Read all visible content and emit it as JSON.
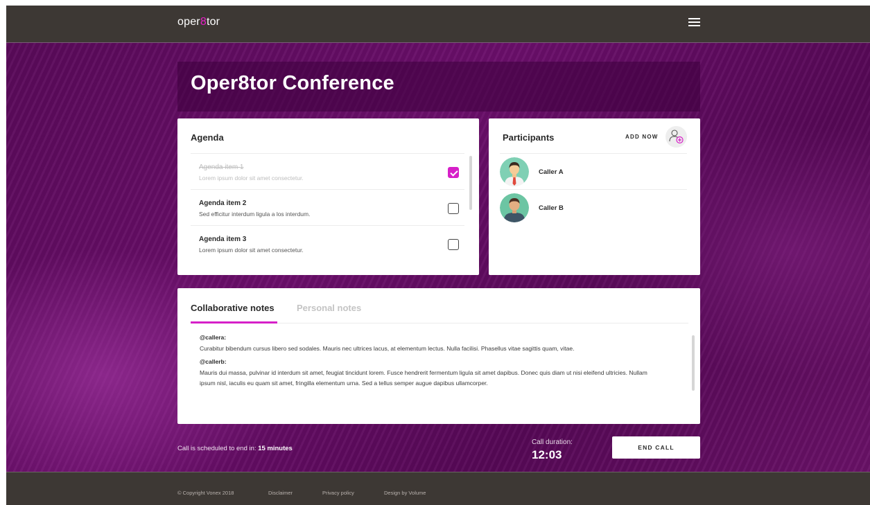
{
  "header": {
    "brand_prefix": "oper",
    "brand_highlight": "8",
    "brand_suffix": "tor",
    "menu_icon": "hamburger-menu-icon"
  },
  "page_title": "Oper8tor Conference",
  "agenda": {
    "title": "Agenda",
    "items": [
      {
        "title": "Agenda item 1",
        "description": "Lorem ipsum dolor sit amet consectetur.",
        "checked": true
      },
      {
        "title": "Agenda item 2",
        "description": "Sed efficitur interdum ligula a los interdum.",
        "checked": false
      },
      {
        "title": "Agenda item 3",
        "description": "Lorem ipsum dolor sit amet consectetur.",
        "checked": false
      }
    ]
  },
  "participants": {
    "title": "Participants",
    "add_label": "ADD NOW",
    "add_icon": "add-user-icon",
    "list": [
      {
        "name": "Caller A",
        "avatar": "male-avatar-icon"
      },
      {
        "name": "Caller B",
        "avatar": "male-avatar-icon"
      }
    ]
  },
  "notes": {
    "tabs": [
      {
        "label": "Collaborative notes",
        "active": true
      },
      {
        "label": "Personal notes",
        "active": false
      }
    ],
    "entries": [
      {
        "author": "@callera:",
        "text": "Curabitur bibendum cursus libero sed sodales. Mauris nec ultrices lacus, at elementum lectus. Nulla facilisi. Phasellus vitae sagittis quam, vitae."
      },
      {
        "author": "@callerb:",
        "text": "Mauris dui massa, pulvinar id interdum sit amet, feugiat tincidunt lorem. Fusce hendrerit fermentum ligula sit amet dapibus. Donec quis diam ut nisi eleifend ultricies. Nullam ipsum nisl, iaculis eu quam sit amet, fringilla elementum urna. Sed a tellus semper augue dapibus ullamcorper."
      }
    ]
  },
  "call": {
    "schedule_prefix": "Call is scheduled to end in:",
    "schedule_value": "15 minutes",
    "duration_label": "Call duration:",
    "duration_value": "12:03",
    "end_label": "END CALL"
  },
  "footer": {
    "copyright": "© Copyright Vonex 2018",
    "disclaimer": "Disclaimer",
    "privacy": "Privacy policy",
    "design": "Design by Volume"
  },
  "colors": {
    "accent": "#d620c8",
    "header_bg": "#3d3834",
    "hero_bg": "#5a0a5a"
  }
}
